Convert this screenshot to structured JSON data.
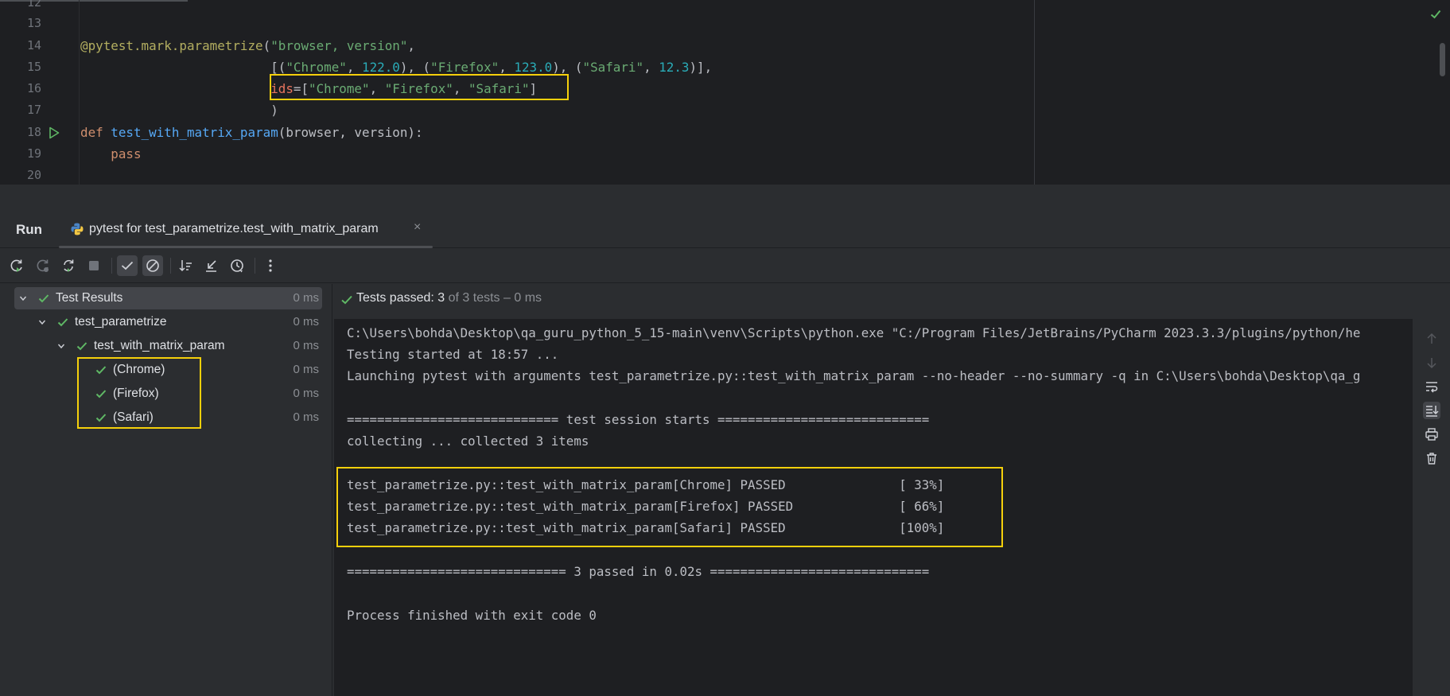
{
  "editor": {
    "line_numbers": [
      "12",
      "13",
      "14",
      "15",
      "16",
      "17",
      "18",
      "19",
      "20"
    ],
    "lines": {
      "l14": {
        "dec": "@pytest.mark.parametrize",
        "p1": "(",
        "s1": "\"browser, version\"",
        "p2": ","
      },
      "l15": {
        "indent": "                         ",
        "a": "[(",
        "s1": "\"Chrome\"",
        "c1": ", ",
        "n1": "122.0",
        "b": "), (",
        "s2": "\"Firefox\"",
        "c2": ", ",
        "n2": "123.0",
        "d": "), (",
        "s3": "\"Safari\"",
        "c3": ", ",
        "n3": "12.3",
        "e": ")],"
      },
      "l16": {
        "indent": "                         ",
        "param": "ids",
        "eq": "=[",
        "s1": "\"Chrome\"",
        "c1": ", ",
        "s2": "\"Firefox\"",
        "c2": ", ",
        "s3": "\"Safari\"",
        "end": "]"
      },
      "l17": {
        "indent": "                         ",
        "text": ")"
      },
      "l18": {
        "kw": "def",
        "sp": " ",
        "fn": "test_with_matrix_param",
        "args": "(browser, version):"
      },
      "l19": {
        "indent": "    ",
        "kw": "pass"
      }
    }
  },
  "run": {
    "title": "Run",
    "tab_label": "pytest for test_parametrize.test_with_matrix_param",
    "tab_close": "×"
  },
  "tree": {
    "rows": [
      {
        "label": "Test Results",
        "time": "0 ms"
      },
      {
        "label": "test_parametrize",
        "time": "0 ms"
      },
      {
        "label": "test_with_matrix_param",
        "time": "0 ms"
      },
      {
        "label": "(Chrome)",
        "time": "0 ms"
      },
      {
        "label": "(Firefox)",
        "time": "0 ms"
      },
      {
        "label": "(Safari)",
        "time": "0 ms"
      }
    ]
  },
  "status": {
    "label": "Tests passed: ",
    "count": "3",
    "rest": " of 3 tests – 0 ms"
  },
  "console": {
    "lines": [
      "C:\\Users\\bohda\\Desktop\\qa_guru_python_5_15-main\\venv\\Scripts\\python.exe \"C:/Program Files/JetBrains/PyCharm 2023.3.3/plugins/python/he",
      "Testing started at 18:57 ...",
      "Launching pytest with arguments test_parametrize.py::test_with_matrix_param --no-header --no-summary -q in C:\\Users\\bohda\\Desktop\\qa_g",
      "",
      "============================ test session starts ============================",
      "collecting ... collected 3 items",
      "",
      "test_parametrize.py::test_with_matrix_param[Chrome] PASSED               [ 33%]",
      "test_parametrize.py::test_with_matrix_param[Firefox] PASSED              [ 66%]",
      "test_parametrize.py::test_with_matrix_param[Safari] PASSED               [100%]",
      "",
      "============================= 3 passed in 0.02s =============================",
      "",
      "Process finished with exit code 0"
    ]
  },
  "icons": {
    "toolbar": [
      "rerun-icon",
      "rerun-failed-icon",
      "toggle-auto-test-icon",
      "stop-icon",
      "show-passed-icon",
      "show-ignored-icon",
      "sort-icon",
      "import-tests-icon",
      "history-icon",
      "more-options-icon"
    ],
    "console_side": [
      "scroll-up-icon",
      "scroll-down-icon",
      "soft-wrap-icon",
      "scroll-to-end-icon",
      "print-icon",
      "clear-all-icon"
    ]
  },
  "colors": {
    "highlight_box": "#f5d00b",
    "pass_green": "#5fb865",
    "background": "#1e1f22",
    "panel": "#2b2d30"
  }
}
